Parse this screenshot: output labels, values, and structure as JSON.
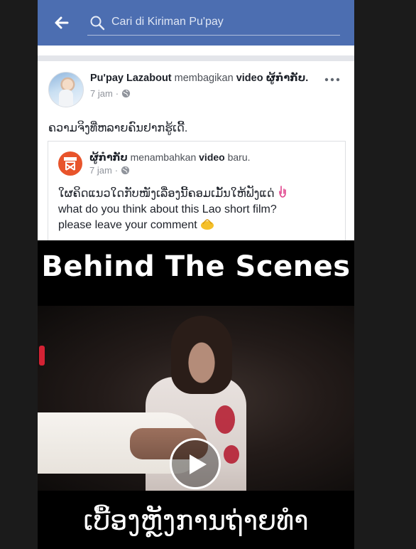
{
  "search": {
    "placeholder": "Cari di Kiriman Pu'pay"
  },
  "post": {
    "author": "Pu'pay Lazabout",
    "action_text": " membagikan ",
    "object": "video",
    "shared_from": " ຜູ້ກຳກັບ.",
    "time": "7 jam",
    "separator": "·",
    "text": "ຄວາມຈິງທີ່ຫລາຍຄົນຢາກຮູ້ເດີ້."
  },
  "shared": {
    "page_name": "ຜູ້ກຳກັບ",
    "action_text": " menambahkan ",
    "object": "video",
    "suffix": " baru.",
    "time": "7 jam",
    "separator": "·",
    "lines": [
      "ໃຜຄິດແນວໃດກັບໜັງເລື່ອງນີ້ຄອມເມັ້ນໃຫ້ຟັງແດ່",
      "what do you think about this Lao short film?",
      "please leave your comment"
    ],
    "emoji_names": [
      "pointing-down-hand-icon",
      "hands-emoji-icon"
    ]
  },
  "video": {
    "title": "Behind The Scenes",
    "caption": "ເບື້ອງຫຼັງການຖ່າຍທຳ"
  },
  "colors": {
    "topbar": "#4c6eb1",
    "text_dark": "#1d2129",
    "text_muted": "#90949c",
    "page_avatar": "#e8542b"
  }
}
